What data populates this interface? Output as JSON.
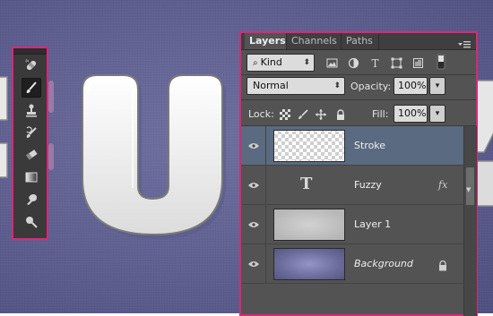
{
  "tools": [
    {
      "name": "spot-healing-brush-icon",
      "active": false
    },
    {
      "name": "brush-icon",
      "active": true
    },
    {
      "name": "clone-stamp-icon",
      "active": false
    },
    {
      "name": "history-brush-icon",
      "active": false
    },
    {
      "name": "eraser-icon",
      "active": false
    },
    {
      "name": "gradient-icon",
      "active": false
    },
    {
      "name": "blur-icon",
      "active": false
    },
    {
      "name": "dodge-icon",
      "active": false
    }
  ],
  "layers_panel": {
    "tabs": [
      "Layers",
      "Channels",
      "Paths"
    ],
    "filter_kind": "Kind",
    "blend_mode": "Normal",
    "opacity_label": "Opacity:",
    "opacity_value": "100%",
    "lock_label": "Lock:",
    "fill_label": "Fill:",
    "fill_value": "100%",
    "layers": [
      {
        "name": "Stroke",
        "type": "pixel-transparent",
        "selected": true
      },
      {
        "name": "Fuzzy",
        "type": "text",
        "fx": "fx"
      },
      {
        "name": "Layer 1",
        "type": "pixel-texture"
      },
      {
        "name": "Background",
        "type": "background",
        "locked": true
      }
    ]
  },
  "colors": {
    "highlight_border": "#d8287a",
    "canvas_bg": "#5e5f8f",
    "selected_row": "#5a6a80"
  }
}
